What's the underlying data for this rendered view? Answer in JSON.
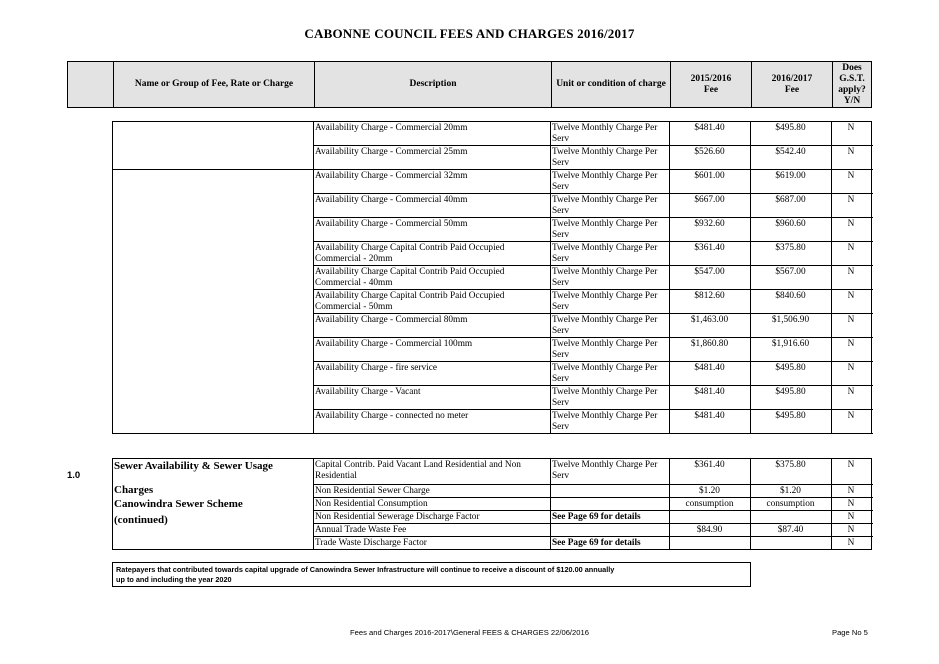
{
  "title": "CABONNE COUNCIL FEES AND CHARGES 2016/2017",
  "header": {
    "name": "Name or Group of Fee, Rate or Charge",
    "description": "Description",
    "unit": "Unit or condition of charge",
    "fee_prev": "2015/2016 Fee",
    "fee_curr": "2016/2017 Fee",
    "gst": "Does G.S.T. apply? Y/N"
  },
  "table1": [
    {
      "description": "Availability Charge - Commercial 20mm",
      "unit": "Twelve Monthly Charge Per Serv",
      "fee_prev": "$481.40",
      "fee_curr": "$495.80",
      "gst": "N"
    },
    {
      "description": "Availability Charge - Commercial 25mm",
      "unit": "Twelve Monthly Charge Per Serv",
      "fee_prev": "$526.60",
      "fee_curr": "$542.40",
      "gst": "N"
    },
    {
      "description": "Availability Charge - Commercial 32mm",
      "unit": "Twelve Monthly Charge Per Serv",
      "fee_prev": "$601.00",
      "fee_curr": "$619.00",
      "gst": "N"
    },
    {
      "description": "Availability Charge - Commercial 40mm",
      "unit": "Twelve Monthly Charge Per Serv",
      "fee_prev": "$667.00",
      "fee_curr": "$687.00",
      "gst": "N"
    },
    {
      "description": "Availability Charge - Commercial 50mm",
      "unit": "Twelve Monthly Charge Per Serv",
      "fee_prev": "$932.60",
      "fee_curr": "$960.60",
      "gst": "N"
    },
    {
      "description": "Availability Charge Capital Contrib Paid Occupied Commercial - 20mm",
      "unit": "Twelve Monthly Charge Per Serv",
      "fee_prev": "$361.40",
      "fee_curr": "$375.80",
      "gst": "N"
    },
    {
      "description": "Availability Charge Capital Contrib Paid Occupied Commercial - 40mm",
      "unit": "Twelve Monthly Charge Per Serv",
      "fee_prev": "$547.00",
      "fee_curr": "$567.00",
      "gst": "N"
    },
    {
      "description": "Availability Charge Capital Contrib Paid Occupied Commercial - 50mm",
      "unit": "Twelve Monthly Charge Per Serv",
      "fee_prev": "$812.60",
      "fee_curr": "$840.60",
      "gst": "N"
    },
    {
      "description": "Availability Charge - Commercial 80mm",
      "unit": "Twelve Monthly Charge Per Serv",
      "fee_prev": "$1,463.00",
      "fee_curr": "$1,506.90",
      "gst": "N"
    },
    {
      "description": "Availability Charge - Commercial 100mm",
      "unit": "Twelve Monthly Charge Per Serv",
      "fee_prev": "$1,860.80",
      "fee_curr": "$1,916.60",
      "gst": "N"
    },
    {
      "description": "Availability Charge - fire service",
      "unit": "Twelve Monthly Charge Per Serv",
      "fee_prev": "$481.40",
      "fee_curr": "$495.80",
      "gst": "N"
    },
    {
      "description": "Availability Charge - Vacant",
      "unit": "Twelve Monthly Charge Per Serv",
      "fee_prev": "$481.40",
      "fee_curr": "$495.80",
      "gst": "N"
    },
    {
      "description": "Availability Charge - connected no meter",
      "unit": "Twelve Monthly Charge Per Serv",
      "fee_prev": "$481.40",
      "fee_curr": "$495.80",
      "gst": "N"
    }
  ],
  "section": {
    "number": "1.0",
    "name_line1": "Sewer Availability & Sewer Usage",
    "name_line2": "Charges",
    "name_line3": "Canowindra Sewer Scheme",
    "name_line4": "(continued)"
  },
  "table2": [
    {
      "description": "Capital Contrib. Paid Vacant Land Residential and Non Residential",
      "unit": "Twelve Monthly Charge Per Serv",
      "fee_prev": "$361.40",
      "fee_curr": "$375.80",
      "gst": "N"
    },
    {
      "description": "Non Residential Sewer Charge",
      "unit": "",
      "fee_prev": "$1.20",
      "fee_curr": "$1.20",
      "gst": "N"
    },
    {
      "description": "Non Residential Consumption",
      "unit": "",
      "fee_prev": "consumption",
      "fee_curr": "consumption",
      "gst": "N"
    },
    {
      "description": "Non Residential Sewerage Discharge Factor",
      "unit": "See Page 69 for details",
      "fee_prev": "",
      "fee_curr": "",
      "gst": "N"
    },
    {
      "description": "Annual Trade Waste  Fee",
      "unit": "",
      "fee_prev": "$84.90",
      "fee_curr": "$87.40",
      "gst": "N"
    },
    {
      "description": "Trade Waste Discharge Factor",
      "unit": "See Page 69 for details",
      "fee_prev": "",
      "fee_curr": "",
      "gst": "N"
    }
  ],
  "note": {
    "line1": "Ratepayers that contributed towards capital upgrade of Canowindra Sewer Infrastructure will continue to receive a discount of $120.00 annually",
    "line2": "up to and including the year 2020"
  },
  "footer": {
    "path": "Fees and Charges 2016-2017\\General FEES & CHARGES 22/06/2016",
    "page": "Page No 5"
  }
}
